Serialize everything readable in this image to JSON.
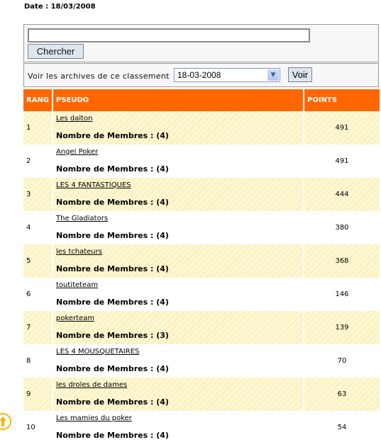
{
  "date_label": "Date : 18/03/2008",
  "search": {
    "value": "",
    "placeholder": "",
    "button_label": "Chercher"
  },
  "archive": {
    "label": "Voir les archives de ce classement",
    "selected": "18-03-2008",
    "button_label": "Voir"
  },
  "table": {
    "headers": [
      "RANG",
      "PSEUDO",
      "POINTS"
    ],
    "members_prefix": "Nombre de Membres :",
    "rows": [
      {
        "rank": "1",
        "team": "Les dalton",
        "members": "Nombre de Membres : (4)",
        "points": "491"
      },
      {
        "rank": "2",
        "team": "Angel Poker",
        "members": "Nombre de Membres : (4)",
        "points": "491"
      },
      {
        "rank": "3",
        "team": "LES 4 FANTASTIQUES",
        "members": "Nombre de Membres : (4)",
        "points": "444"
      },
      {
        "rank": "4",
        "team": "The Gladiators",
        "members": "Nombre de Membres : (4)",
        "points": "380"
      },
      {
        "rank": "5",
        "team": "les tchateurs",
        "members": "Nombre de Membres : (4)",
        "points": "368"
      },
      {
        "rank": "6",
        "team": "toutiteteam",
        "members": "Nombre de Membres : (4)",
        "points": "146"
      },
      {
        "rank": "7",
        "team": "pokerteam",
        "members": "Nombre de Membres : (3)",
        "points": "139"
      },
      {
        "rank": "8",
        "team": "LES 4 MOUSQUETAIRES",
        "members": "Nombre de Membres : (4)",
        "points": "70"
      },
      {
        "rank": "9",
        "team": "les droles de dames",
        "members": "Nombre de Membres : (4)",
        "points": "63"
      },
      {
        "rank": "10",
        "team": "Les mamies du poker",
        "members": "Nombre de Membres : (4)",
        "points": "54"
      }
    ]
  },
  "icons": {
    "back_to_top": "arrow-up-circle-icon"
  },
  "colors": {
    "header_bg": "#ff6600",
    "stripe_bg": "#fdf7d2",
    "icon_accent": "#f4b400"
  }
}
